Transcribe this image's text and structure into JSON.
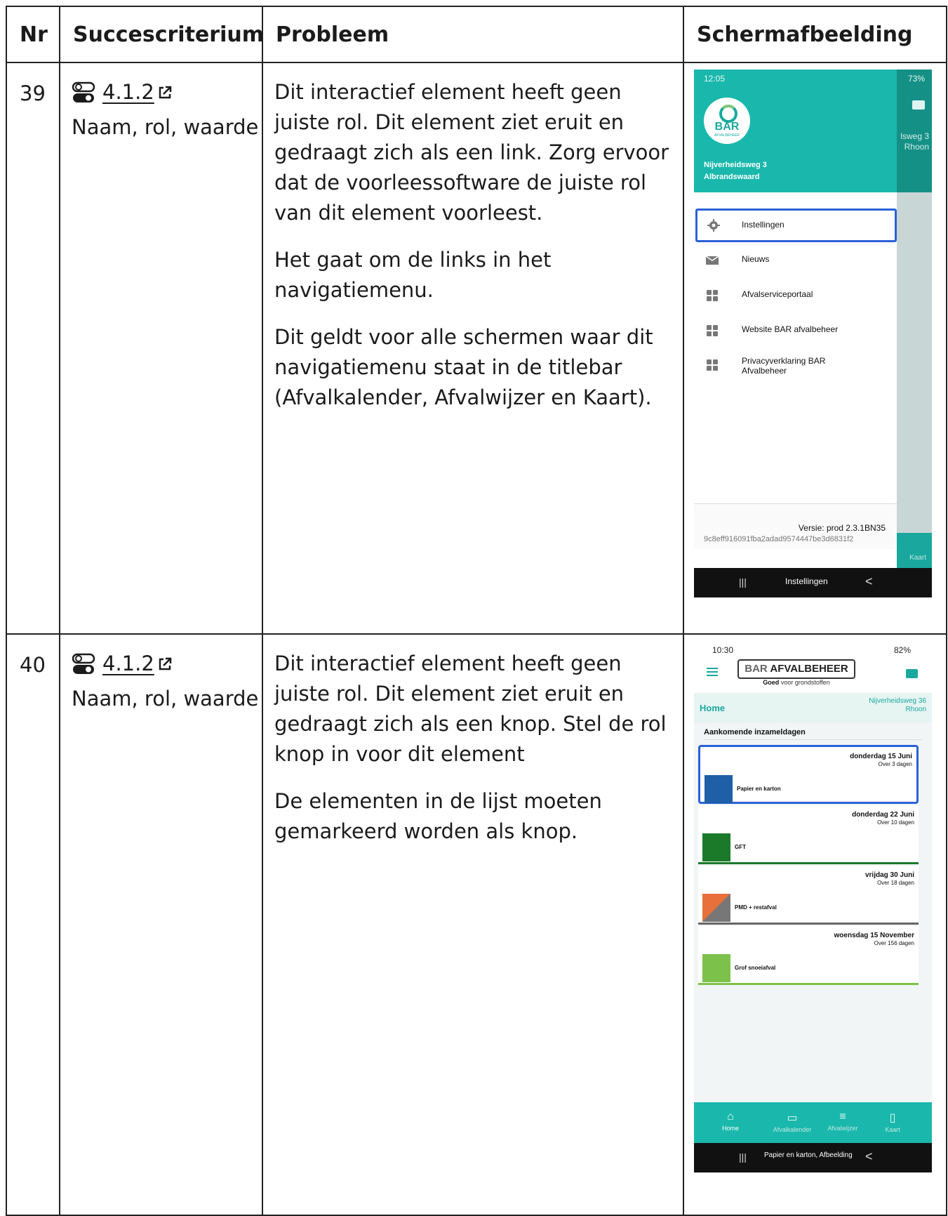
{
  "table": {
    "headers": [
      "Nr",
      "Succescriterium",
      "Probleem",
      "Schermafbeelding"
    ]
  },
  "rows": [
    {
      "nr": "39",
      "criterion_code": "4.1.2",
      "criterion_name": "Naam, rol, waarde",
      "problem": [
        "Dit interactief element heeft geen juiste rol. Dit element ziet eruit en gedraagt zich als een link. Zorg ervoor dat de voorleessoftware de juiste rol van dit element voorleest.",
        "Het gaat om de links in het navigatiemenu.",
        "Dit geldt voor alle schermen waar dit navigatiemenu staat in de titlebar (Afvalkalender, Afvalwijzer en Kaart)."
      ],
      "screenshot": {
        "status_time": "12:05",
        "status_right": "73%",
        "bg_address": [
          "lsweg 3",
          "Rhoon"
        ],
        "logo_text": "BAR",
        "logo_sub": "AFVALBEHEER",
        "address": [
          "Nijverheidsweg 3",
          "Albrandswaard"
        ],
        "menu_items": [
          "Instellingen",
          "Nieuws",
          "Afvalserviceportaal",
          "Website BAR afvalbeheer",
          "Privacyverklaring BAR Afvalbeheer"
        ],
        "version_line": "Versie:  prod 2.3.1BN35",
        "hash_line": "9c8eff916091fba2adad9574447be3d6831f2",
        "bg_nav_label": "Kaart",
        "navbar_label": "Instellingen",
        "navbar_lines": "|||",
        "navbar_back": "<"
      }
    },
    {
      "nr": "40",
      "criterion_code": "4.1.2",
      "criterion_name": "Naam, rol, waarde",
      "problem": [
        "Dit interactief element heeft geen juiste rol. Dit element ziet eruit en gedraagt zich als een knop. Stel de rol knop in voor dit element",
        "De elementen in de lijst moeten gemarkeerd worden als knop."
      ],
      "screenshot": {
        "status_time": "10:30",
        "status_right": "82%",
        "logo_bar": "BAR",
        "logo_main": "AFVALBEHEER",
        "tagline_bold": "Goed",
        "tagline_rest": "voor grondstoffen",
        "subbar_title": "Home",
        "subbar_address": [
          "Nijverheidsweg 36",
          "Rhoon"
        ],
        "section_title": "Aankomende inzameldagen",
        "cards": [
          {
            "date": "donderdag 15 Juni",
            "in": "Over 3 dagen",
            "label": "Papier en karton",
            "color": "#1f5fa8",
            "line": "#2a62d6"
          },
          {
            "date": "donderdag 22 Juni",
            "in": "Over 10 dagen",
            "label": "GFT",
            "color": "#1a7a2a",
            "line": "#1a7a2a"
          },
          {
            "date": "vrijdag 30 Juni",
            "in": "Over 18 dagen",
            "label": "PMD + restafval",
            "color": "#e8703a",
            "line": "#666666"
          },
          {
            "date": "woensdag 15 November",
            "in": "Over 156 dagen",
            "label": "Grof snoeiafval",
            "color": "#7cc14a",
            "line": "#7cc14a"
          }
        ],
        "nav": [
          "Home",
          "Afvalkalender",
          "Afvalwijzer",
          "Kaart"
        ],
        "navbar_label": "Papier en karton, Afbeelding",
        "navbar_lines": "|||",
        "navbar_back": "<"
      }
    }
  ]
}
